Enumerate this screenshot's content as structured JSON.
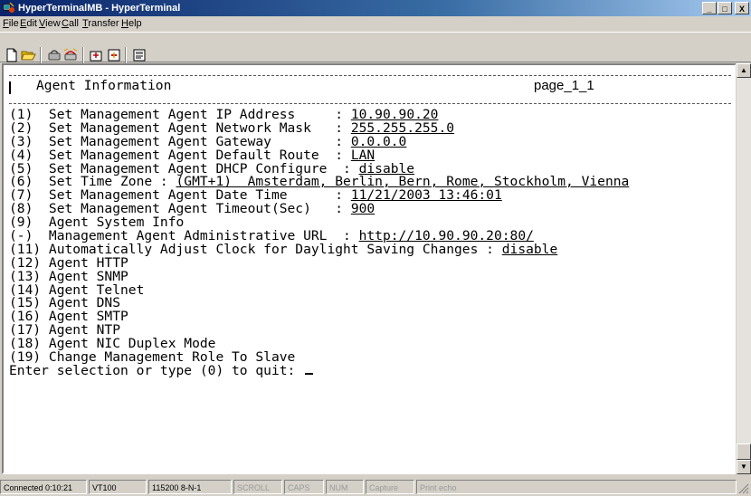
{
  "window": {
    "title": "HyperTerminalMB - HyperTerminal",
    "controls": {
      "minimize": "_",
      "maximize": "□",
      "close": "X"
    }
  },
  "menu": [
    {
      "pre": "",
      "mn": "F",
      "post": "ile"
    },
    {
      "pre": "",
      "mn": "E",
      "post": "dit"
    },
    {
      "pre": "",
      "mn": "V",
      "post": "iew"
    },
    {
      "pre": "",
      "mn": "C",
      "post": "all"
    },
    {
      "pre": "",
      "mn": "T",
      "post": "ransfer"
    },
    {
      "pre": "",
      "mn": "H",
      "post": "elp"
    }
  ],
  "toolbar": [
    {
      "name": "new-connection-icon"
    },
    {
      "name": "open-icon"
    },
    {
      "name": "disconnect-icon"
    },
    {
      "name": "dial-icon"
    },
    {
      "name": "send-file-icon"
    },
    {
      "name": "receive-file-icon"
    },
    {
      "name": "properties-icon"
    }
  ],
  "terminal": {
    "header_title": "Agent Information",
    "header_page": "page_1_1",
    "lines": [
      [
        {
          "t": "(1)  Set Management Agent IP Address     : "
        },
        {
          "t": "10.90.90.20",
          "u": true
        }
      ],
      [
        {
          "t": "(2)  Set Management Agent Network Mask   : "
        },
        {
          "t": "255.255.255.0",
          "u": true
        }
      ],
      [
        {
          "t": "(3)  Set Management Agent Gateway        : "
        },
        {
          "t": "0.0.0.0",
          "u": true
        }
      ],
      [
        {
          "t": "(4)  Set Management Agent Default Route  : "
        },
        {
          "t": "LAN",
          "u": true
        }
      ],
      [
        {
          "t": "(5)  Set Management Agent DHCP Configure  : "
        },
        {
          "t": "disable",
          "u": true
        }
      ],
      [
        {
          "t": "(6)  Set Time Zone : "
        },
        {
          "t": "(GMT+1)  Amsterdam, Berlin, Bern, Rome, Stockholm, Vienna",
          "u": true
        }
      ],
      [
        {
          "t": "(7)  Set Management Agent Date Time      : "
        },
        {
          "t": "11/21/2003 13:46:01",
          "u": true
        }
      ],
      [
        {
          "t": "(8)  Set Management Agent Timeout(Sec)   : "
        },
        {
          "t": "900",
          "u": true
        }
      ],
      [
        {
          "t": "(9)  Agent System Info"
        }
      ],
      [
        {
          "t": "(-)  Management Agent Administrative URL  : "
        },
        {
          "t": "http://10.90.90.20:80/",
          "u": true
        }
      ],
      [
        {
          "t": "(11) Automatically Adjust Clock for Daylight Saving Changes : "
        },
        {
          "t": "disable",
          "u": true
        }
      ],
      [
        {
          "t": "(12) Agent HTTP"
        }
      ],
      [
        {
          "t": "(13) Agent SNMP"
        }
      ],
      [
        {
          "t": "(14) Agent Telnet"
        }
      ],
      [
        {
          "t": "(15) Agent DNS"
        }
      ],
      [
        {
          "t": "(16) Agent SMTP"
        }
      ],
      [
        {
          "t": "(17) Agent NTP"
        }
      ],
      [
        {
          "t": "(18) Agent NIC Duplex Mode"
        }
      ],
      [
        {
          "t": "(19) Change Management Role To Slave"
        }
      ],
      [
        {
          "t": "Enter selection or type (0) to quit: "
        }
      ]
    ]
  },
  "status": [
    {
      "text": "Connected 0:10:21",
      "dim": false
    },
    {
      "text": "VT100",
      "dim": false
    },
    {
      "text": "115200 8-N-1",
      "dim": false
    },
    {
      "text": "SCROLL",
      "dim": true
    },
    {
      "text": "CAPS",
      "dim": true
    },
    {
      "text": "NUM",
      "dim": true
    },
    {
      "text": "Capture",
      "dim": true
    },
    {
      "text": "Print echo",
      "dim": true
    }
  ],
  "colors": {
    "titlebar": "#0a246a",
    "face": "#d4d0c8",
    "terminal_bg": "#ffffff"
  }
}
